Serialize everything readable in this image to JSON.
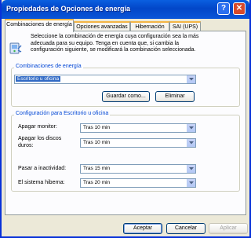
{
  "window": {
    "title": "Propiedades de Opciones de energía",
    "help_label": "?",
    "close_label": "✕"
  },
  "tabs": [
    {
      "label": "Combinaciones de energía",
      "active": true
    },
    {
      "label": "Opciones avanzadas",
      "active": false
    },
    {
      "label": "Hibernación",
      "active": false
    },
    {
      "label": "SAI (UPS)",
      "active": false
    }
  ],
  "description": "Seleccione la combinación de energía cuya configuración sea la más adecuada para su equipo. Tenga en cuenta que, si cambia la configuración siguiente, se modificará la combinación seleccionada.",
  "schemes": {
    "group_label": "Combinaciones de energía",
    "selected": "Escritorio u oficina",
    "save_label": "Guardar como...",
    "delete_label": "Eliminar"
  },
  "settings": {
    "group_label": "Configuración para Escritorio u oficina",
    "monitor_label": "Apagar monitor:",
    "monitor_value": "Tras 10 min",
    "disks_label": "Apagar los discos duros:",
    "disks_value": "Tras 10 min",
    "standby_label": "Pasar a inactividad:",
    "standby_value": "Tras 15 min",
    "hibernate_label": "El sistema hiberna:",
    "hibernate_value": "Tras 20 min"
  },
  "buttons": {
    "ok": "Aceptar",
    "cancel": "Cancelar",
    "apply": "Aplicar"
  },
  "colors": {
    "titlebar": "#0246c8",
    "accent": "#316ac5",
    "group_label": "#0046d5"
  }
}
